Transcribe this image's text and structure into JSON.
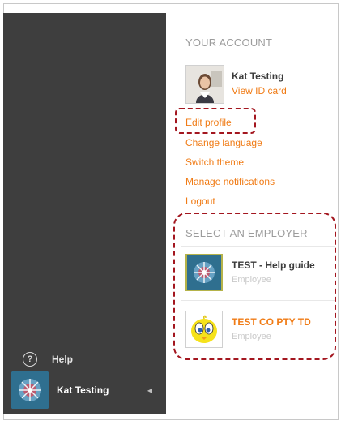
{
  "account": {
    "heading": "YOUR ACCOUNT",
    "user_name": "Kat Testing",
    "view_id_card": "View ID card",
    "links": {
      "edit_profile": "Edit profile",
      "change_language": "Change language",
      "switch_theme": "Switch theme",
      "manage_notifications": "Manage notifications",
      "logout": "Logout"
    }
  },
  "employers": {
    "heading": "SELECT AN EMPLOYER",
    "items": [
      {
        "name": "TEST - Help guide",
        "role": "Employee",
        "selected": false
      },
      {
        "name": "TEST CO PTY TD",
        "role": "Employee",
        "selected": true
      }
    ]
  },
  "sidebar": {
    "help_label": "Help",
    "user_name": "Kat Testing"
  },
  "colors": {
    "accent": "#f07b15",
    "sidebar_bg": "#3e3e3e",
    "annotation": "#a3161f"
  }
}
